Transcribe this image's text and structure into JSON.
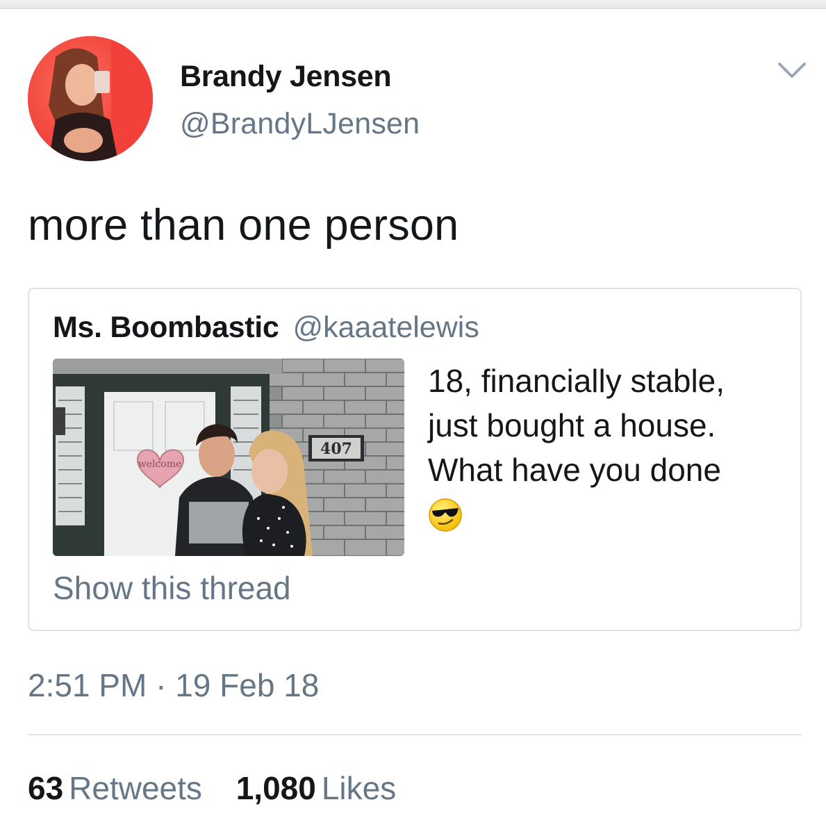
{
  "tweet": {
    "author": {
      "display_name": "Brandy Jensen",
      "handle": "@BrandyLJensen",
      "avatar_icon": "profile-photo"
    },
    "menu_icon": "chevron-down-icon",
    "text": "more than one person",
    "quoted_tweet": {
      "display_name": "Ms. Boombastic",
      "handle": "@kaaatelewis",
      "text_lines": [
        "18, financially stable,",
        "just bought a house.",
        "What have you done"
      ],
      "emoji": "smirking-face-with-sunglasses",
      "image_texts": {
        "welcome_sign": "welcome",
        "house_number": "407"
      },
      "show_thread_label": "Show this thread"
    },
    "time": "2:51 PM",
    "separator": "·",
    "date": "19 Feb 18",
    "retweets": {
      "count": "63",
      "label": "Retweets"
    },
    "likes": {
      "count": "1,080",
      "label": "Likes"
    }
  },
  "colors": {
    "primary_text": "#14171a",
    "secondary_text": "#657786",
    "border": "#dde2e7"
  }
}
